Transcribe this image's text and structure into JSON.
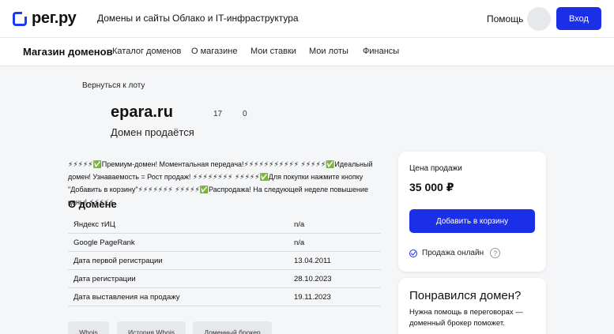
{
  "header": {
    "logo_text": "рег.ру",
    "nav": [
      "Домены и сайты",
      "Облако и IT-инфраструктура"
    ],
    "help_label": "Помощь",
    "login_label": "Вход"
  },
  "subheader": {
    "title": "Магазин доменов",
    "nav": [
      "Каталог доменов",
      "О магазине",
      "Мои ставки",
      "Мои лоты",
      "Финансы"
    ]
  },
  "lot": {
    "back_label": "Вернуться к лоту",
    "domain": "epara.ru",
    "stat_1": "17",
    "stat_2": "0",
    "status": "Домен продаётся",
    "description": "⚡⚡⚡⚡⚡✅Премиум-домен! Моментальная передача!⚡⚡⚡⚡⚡⚡⚡⚡⚡⚡⚡ ⚡⚡⚡⚡⚡✅Идеальный домен! Узнаваемость = Рост продаж! ⚡⚡⚡⚡⚡⚡⚡⚡ ⚡⚡⚡⚡⚡✅Для покупки нажмите кнопку \"Добавить в корзину\"⚡⚡⚡⚡⚡⚡⚡ ⚡⚡⚡⚡⚡✅Распродажа! На следующей неделе повышение цены! ⚡⚡⚡⚡⚡"
  },
  "about": {
    "title": "О домене",
    "rows": [
      {
        "key": "Яндекс тИЦ",
        "value": "n/a"
      },
      {
        "key": "Google PageRank",
        "value": "n/a"
      },
      {
        "key": "Дата первой регистрации",
        "value": "13.04.2011"
      },
      {
        "key": "Дата регистрации",
        "value": "28.10.2023"
      },
      {
        "key": "Дата выставления на продажу",
        "value": "19.11.2023"
      }
    ]
  },
  "tools": [
    "Whois",
    "История Whois",
    "Доменный брокер"
  ],
  "price_card": {
    "label": "Цена продажи",
    "price": "35 000 ₽",
    "cart_label": "Добавить в корзину",
    "online_label": "Продажа онлайн",
    "help_glyph": "?"
  },
  "broker_card": {
    "title": "Понравился домен?",
    "text": "Нужна помощь в переговорах — доменный брокер поможет."
  },
  "colors": {
    "accent": "#1b2ee8",
    "background": "#f5f6f8"
  }
}
